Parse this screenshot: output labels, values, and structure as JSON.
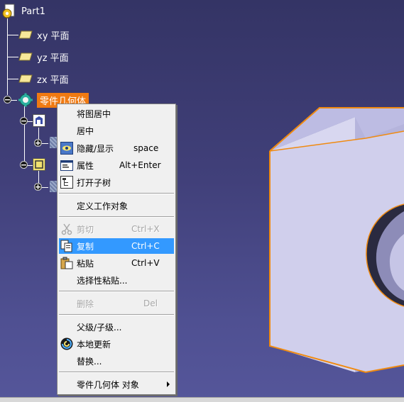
{
  "tree": {
    "root_label": "Part1",
    "planes": [
      {
        "label": "xy 平面"
      },
      {
        "label": "yz 平面"
      },
      {
        "label": "zx 平面"
      }
    ],
    "body_label": "零件几何体"
  },
  "context_menu": {
    "items": [
      {
        "label": "将图居中",
        "shortcut": "",
        "icon": "none"
      },
      {
        "label": "居中",
        "shortcut": "",
        "icon": "none"
      },
      {
        "label": "隐藏/显示",
        "shortcut": "space",
        "icon": "hide-show-icon"
      },
      {
        "label": "属性",
        "shortcut": "Alt+Enter",
        "icon": "properties-icon"
      },
      {
        "label": "打开子树",
        "shortcut": "",
        "icon": "open-subtree-icon"
      },
      {
        "label": "定义工作对象",
        "shortcut": "",
        "icon": "none"
      },
      {
        "label": "剪切",
        "shortcut": "Ctrl+X",
        "icon": "scissors-icon",
        "disabled": true
      },
      {
        "label": "复制",
        "shortcut": "Ctrl+C",
        "icon": "copy-icon",
        "highlighted": true
      },
      {
        "label": "粘贴",
        "shortcut": "Ctrl+V",
        "icon": "paste-icon"
      },
      {
        "label": "选择性粘贴...",
        "shortcut": "",
        "icon": "none"
      },
      {
        "label": "删除",
        "shortcut": "Del",
        "icon": "none",
        "disabled": true
      },
      {
        "label": "父级/子级...",
        "shortcut": "",
        "icon": "none"
      },
      {
        "label": "本地更新",
        "shortcut": "",
        "icon": "local-update-icon"
      },
      {
        "label": "替换...",
        "shortcut": "",
        "icon": "none"
      },
      {
        "label": "零件几何体 对象",
        "shortcut": "",
        "icon": "none",
        "submenu": true
      }
    ]
  },
  "colors": {
    "background_top": "#343465",
    "background_bottom": "#55569a",
    "selection": "#3399ff",
    "body_highlight": "#f07a12",
    "model_face": "#c9c8ea",
    "model_edge": "#f08a10"
  }
}
